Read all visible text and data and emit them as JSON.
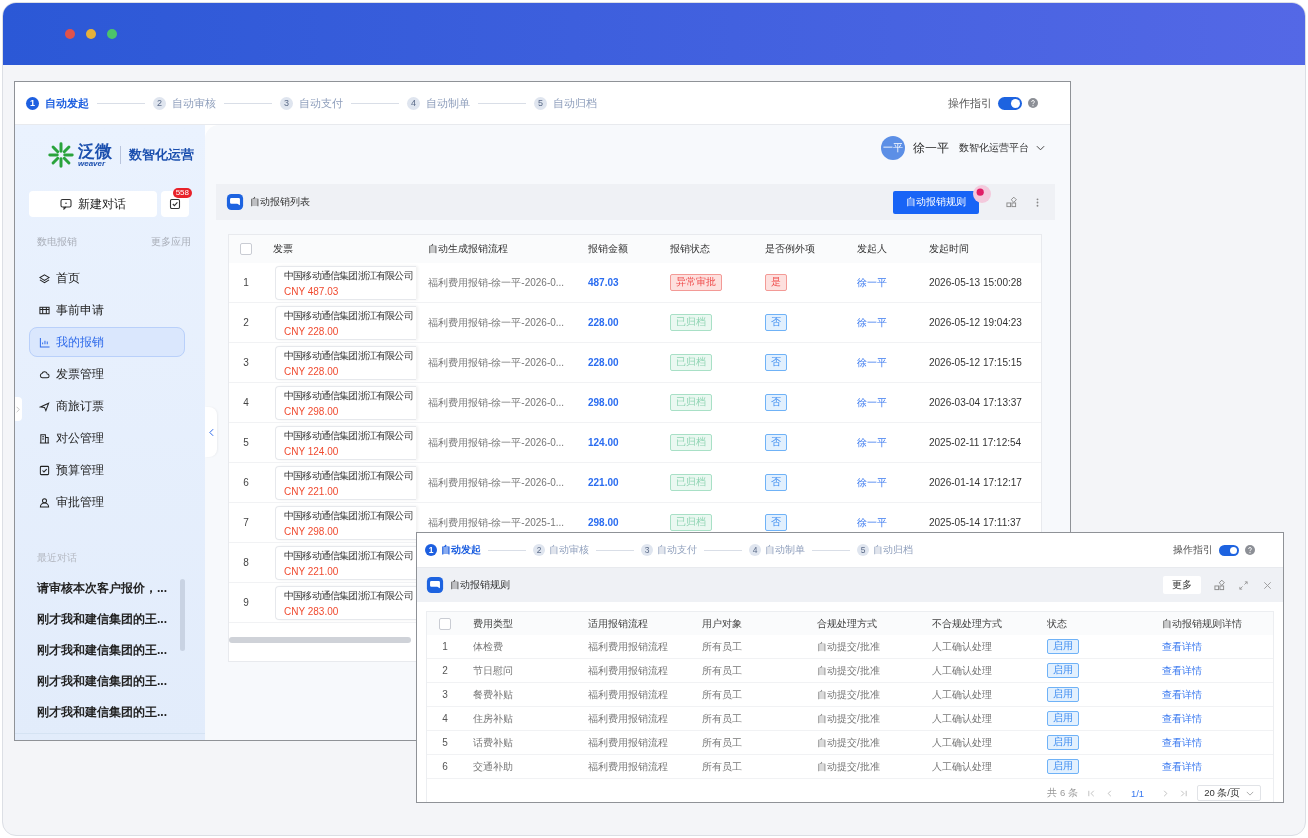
{
  "main_window": {
    "steps": [
      {
        "number": "1",
        "label": "自动发起",
        "selected": true
      },
      {
        "number": "2",
        "label": "自动审核",
        "selected": false
      },
      {
        "number": "3",
        "label": "自动支付",
        "selected": false
      },
      {
        "number": "4",
        "label": "自动制单",
        "selected": false
      },
      {
        "number": "5",
        "label": "自动归档",
        "selected": false
      }
    ],
    "guide": {
      "label": "操作指引",
      "on": true
    },
    "logo": {
      "name": "泛微",
      "latin": "weaver",
      "product": "数智化运营"
    },
    "new_chat": "新建对话",
    "badge": "558",
    "section_title": "数电报销",
    "more_apps": "更多应用",
    "nav": [
      {
        "label": "首页",
        "selected": false
      },
      {
        "label": "事前申请",
        "selected": false
      },
      {
        "label": "我的报销",
        "selected": true
      },
      {
        "label": "发票管理",
        "selected": false
      },
      {
        "label": "商旅订票",
        "selected": false
      },
      {
        "label": "对公管理",
        "selected": false
      },
      {
        "label": "预算管理",
        "selected": false
      },
      {
        "label": "审批管理",
        "selected": false
      }
    ],
    "recent_title": "最近对话",
    "recent": [
      "请审核本次客户报价，...",
      "刚才我和建信集团的王...",
      "刚才我和建信集团的王...",
      "刚才我和建信集团的王...",
      "刚才我和建信集团的王..."
    ],
    "user": {
      "avatar": "一平",
      "name": "徐一平",
      "platform": "数智化运营平台"
    },
    "list_title": "自动报销列表",
    "rule_button": "自动报销规则",
    "select_all": {
      "checked": false
    },
    "columns": [
      "发票",
      "自动生成报销流程",
      "报销金额",
      "报销状态",
      "是否例外项",
      "发起人",
      "发起时间"
    ],
    "rows": [
      {
        "index": "1",
        "company": "中国移动通信集团浙江有限公司",
        "amount_label": "CNY 487.03",
        "process": "福利费用报销-徐一平-2026-0...",
        "amount": "487.03",
        "status": {
          "text": "异常审批",
          "kind": "abnormal"
        },
        "exception": {
          "text": "是",
          "kind": "yes"
        },
        "initiator": "徐一平",
        "time": "2026-05-13 15:00:28"
      },
      {
        "index": "2",
        "company": "中国移动通信集团浙江有限公司",
        "amount_label": "CNY 228.00",
        "process": "福利费用报销-徐一平-2026-0...",
        "amount": "228.00",
        "status": {
          "text": "已归档",
          "kind": "archived"
        },
        "exception": {
          "text": "否",
          "kind": "no"
        },
        "initiator": "徐一平",
        "time": "2026-05-12 19:04:23"
      },
      {
        "index": "3",
        "company": "中国移动通信集团浙江有限公司",
        "amount_label": "CNY 228.00",
        "process": "福利费用报销-徐一平-2026-0...",
        "amount": "228.00",
        "status": {
          "text": "已归档",
          "kind": "archived"
        },
        "exception": {
          "text": "否",
          "kind": "no"
        },
        "initiator": "徐一平",
        "time": "2026-05-12 17:15:15"
      },
      {
        "index": "4",
        "company": "中国移动通信集团浙江有限公司",
        "amount_label": "CNY 298.00",
        "process": "福利费用报销-徐一平-2026-0...",
        "amount": "298.00",
        "status": {
          "text": "已归档",
          "kind": "archived"
        },
        "exception": {
          "text": "否",
          "kind": "no"
        },
        "initiator": "徐一平",
        "time": "2026-03-04 17:13:37"
      },
      {
        "index": "5",
        "company": "中国移动通信集团浙江有限公司",
        "amount_label": "CNY 124.00",
        "process": "福利费用报销-徐一平-2026-0...",
        "amount": "124.00",
        "status": {
          "text": "已归档",
          "kind": "archived"
        },
        "exception": {
          "text": "否",
          "kind": "no"
        },
        "initiator": "徐一平",
        "time": "2025-02-11 17:12:54"
      },
      {
        "index": "6",
        "company": "中国移动通信集团浙江有限公司",
        "amount_label": "CNY 221.00",
        "process": "福利费用报销-徐一平-2026-0...",
        "amount": "221.00",
        "status": {
          "text": "已归档",
          "kind": "archived"
        },
        "exception": {
          "text": "否",
          "kind": "no"
        },
        "initiator": "徐一平",
        "time": "2026-01-14 17:12:17"
      },
      {
        "index": "7",
        "company": "中国移动通信集团浙江有限公司",
        "amount_label": "CNY 298.00",
        "process": "福利费用报销-徐一平-2025-1...",
        "amount": "298.00",
        "status": {
          "text": "已归档",
          "kind": "archived"
        },
        "exception": {
          "text": "否",
          "kind": "no"
        },
        "initiator": "徐一平",
        "time": "2025-05-14 17:11:37"
      },
      {
        "index": "8",
        "company": "中国移动通信集团浙江有限公司",
        "amount_label": "CNY 221.00"
      },
      {
        "index": "9",
        "company": "中国移动通信集团浙江有限公司",
        "amount_label": "CNY 283.00"
      }
    ]
  },
  "rules_window": {
    "steps": [
      {
        "number": "1",
        "label": "自动发起",
        "selected": true
      },
      {
        "number": "2",
        "label": "自动审核",
        "selected": false
      },
      {
        "number": "3",
        "label": "自动支付",
        "selected": false
      },
      {
        "number": "4",
        "label": "自动制单",
        "selected": false
      },
      {
        "number": "5",
        "label": "自动归档",
        "selected": false
      }
    ],
    "guide": {
      "label": "操作指引",
      "on": true
    },
    "title": "自动报销规则",
    "more": "更多",
    "select_all": {
      "checked": false
    },
    "columns": [
      "费用类型",
      "适用报销流程",
      "用户对象",
      "合规处理方式",
      "不合规处理方式",
      "状态",
      "自动报销规则详情"
    ],
    "rows": [
      {
        "index": "1",
        "type": "体检费",
        "process": "福利费用报销流程",
        "users": "所有员工",
        "compliant": "自动提交/批准",
        "noncompliant": "人工确认处理",
        "status": {
          "text": "启用",
          "on": true
        },
        "detail": "查看详情"
      },
      {
        "index": "2",
        "type": "节日慰问",
        "process": "福利费用报销流程",
        "users": "所有员工",
        "compliant": "自动提交/批准",
        "noncompliant": "人工确认处理",
        "status": {
          "text": "启用",
          "on": true
        },
        "detail": "查看详情"
      },
      {
        "index": "3",
        "type": "餐费补贴",
        "process": "福利费用报销流程",
        "users": "所有员工",
        "compliant": "自动提交/批准",
        "noncompliant": "人工确认处理",
        "status": {
          "text": "启用",
          "on": true
        },
        "detail": "查看详情"
      },
      {
        "index": "4",
        "type": "住房补贴",
        "process": "福利费用报销流程",
        "users": "所有员工",
        "compliant": "自动提交/批准",
        "noncompliant": "人工确认处理",
        "status": {
          "text": "启用",
          "on": true
        },
        "detail": "查看详情"
      },
      {
        "index": "5",
        "type": "话费补贴",
        "process": "福利费用报销流程",
        "users": "所有员工",
        "compliant": "自动提交/批准",
        "noncompliant": "人工确认处理",
        "status": {
          "text": "启用",
          "on": true
        },
        "detail": "查看详情"
      },
      {
        "index": "6",
        "type": "交通补助",
        "process": "福利费用报销流程",
        "users": "所有员工",
        "compliant": "自动提交/批准",
        "noncompliant": "人工确认处理",
        "status": {
          "text": "启用",
          "on": true
        },
        "detail": "查看详情"
      }
    ],
    "pagination": {
      "total": "共 6 条",
      "page": "1/1",
      "page_size": "20 条/页"
    }
  }
}
